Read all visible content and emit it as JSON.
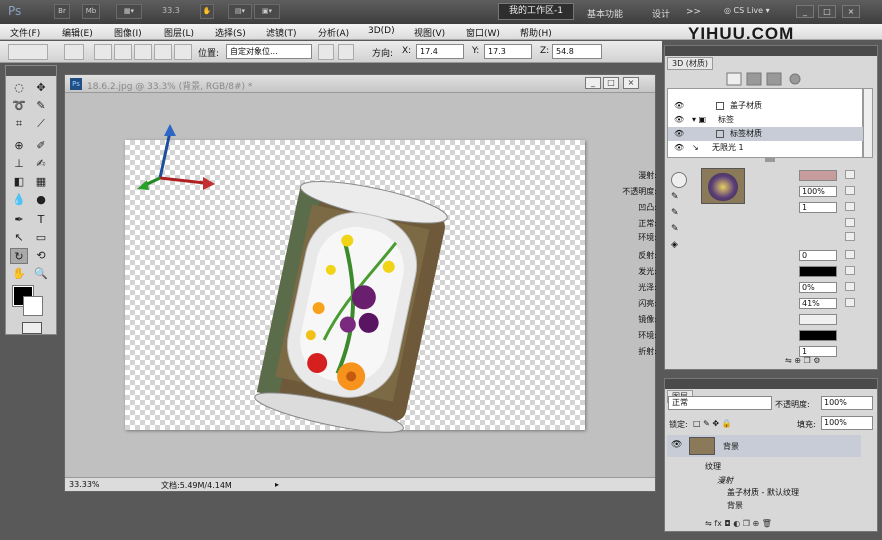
{
  "app": {
    "logo_short": "Ps",
    "zoom_field": "33.3"
  },
  "workspace": {
    "active": "我的工作区-1",
    "items": [
      "基本功能",
      "设计",
      ">>"
    ],
    "cs_live": "CS Live"
  },
  "window_buttons": [
    "_",
    "□",
    "×"
  ],
  "menus": [
    "文件(F)",
    "编辑(E)",
    "图像(I)",
    "图层(L)",
    "选择(S)",
    "滤镜(T)",
    "分析(A)",
    "3D(D)",
    "视图(V)",
    "窗口(W)",
    "帮助(H)"
  ],
  "watermark": "YIHUU.COM",
  "options_bar": {
    "position_label": "位置:",
    "position_value": "自定对象位...",
    "orientation_label": "方向:",
    "x_label": "X:",
    "x_value": "17.4",
    "y_label": "Y:",
    "y_value": "17.3",
    "z_label": "Z:",
    "z_value": "54.8"
  },
  "document": {
    "title": "18.6.2.jpg @ 33.3% (背景, RGB/8#) *",
    "zoom": "33.33%",
    "doc_size": "文档:5.49M/4.14M"
  },
  "panel_3d": {
    "tab": "3D (材质)",
    "tree": [
      {
        "label": ""
      },
      {
        "label": "盖子材质"
      },
      {
        "label": "标签"
      },
      {
        "label": "标签材质"
      },
      {
        "label": "无限光 1"
      }
    ],
    "material": [
      {
        "label": "漫射:",
        "value": ""
      },
      {
        "label": "不透明度:",
        "value": "100%"
      },
      {
        "label": "凹凸:",
        "value": "1"
      },
      {
        "label": "正常:",
        "value": ""
      },
      {
        "label": "环境:",
        "value": ""
      },
      {
        "label": "反射:",
        "value": "0"
      },
      {
        "label": "发光:",
        "value": ""
      },
      {
        "label": "光泽:",
        "value": "0%"
      },
      {
        "label": "闪亮:",
        "value": "41%"
      },
      {
        "label": "镜像:",
        "value": ""
      },
      {
        "label": "环境:",
        "value": ""
      },
      {
        "label": "折射:",
        "value": "1"
      }
    ],
    "colors": {
      "diffuse": "#c79c9c",
      "glow": "#000000",
      "mirror": "#f0f0f0",
      "environment": "#000000"
    }
  },
  "layers_panel": {
    "tab": "图层",
    "blend": "正常",
    "opacity_label": "不透明度:",
    "opacity": "100%",
    "lock_label": "锁定:",
    "fill_label": "填充:",
    "fill": "100%",
    "layer_name": "背景",
    "sub": [
      "纹理",
      "漫射",
      "盖子材质 - 默认纹理",
      "背景"
    ]
  }
}
